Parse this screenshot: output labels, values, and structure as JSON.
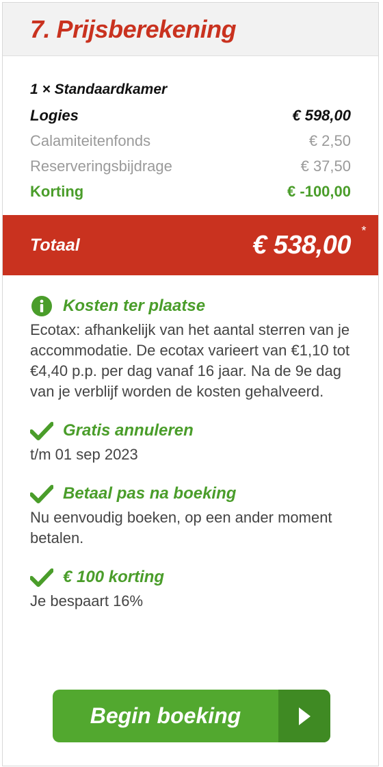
{
  "header": {
    "title": "7. Prijsberekening"
  },
  "room": "1 × Standaardkamer",
  "price_rows": [
    {
      "label": "Logies",
      "value": "€ 598,00"
    },
    {
      "label": "Calamiteitenfonds",
      "value": "€ 2,50"
    },
    {
      "label": "Reserveringsbijdrage",
      "value": "€ 37,50"
    },
    {
      "label": "Korting",
      "value": "€ -100,00"
    }
  ],
  "total": {
    "label": "Totaal",
    "amount": "€ 538,00",
    "footnote": "*"
  },
  "sections": [
    {
      "title": "Kosten ter plaatse",
      "icon": "info-icon",
      "text": "Ecotax: afhankelijk van het aantal sterren van je accommodatie. De ecotax varieert van €1,10 tot €4,40 p.p. per dag vanaf 16 jaar. Na de 9e dag van je verblijf worden de kosten gehalveerd."
    },
    {
      "title": "Gratis annuleren",
      "icon": "check-icon",
      "text": "t/m 01 sep 2023"
    },
    {
      "title": "Betaal pas na boeking",
      "icon": "check-icon",
      "text": "Nu eenvoudig boeken, op een ander moment betalen."
    },
    {
      "title": "€ 100 korting",
      "icon": "check-icon",
      "text": "Je bespaart 16%"
    }
  ],
  "button": {
    "label": "Begin boeking",
    "icon": "chevron-right-icon"
  },
  "colors": {
    "accent_red": "#c9321f",
    "accent_green": "#4a9d2a",
    "button_green": "#52a82f",
    "button_dark_green": "#3f8a23"
  }
}
